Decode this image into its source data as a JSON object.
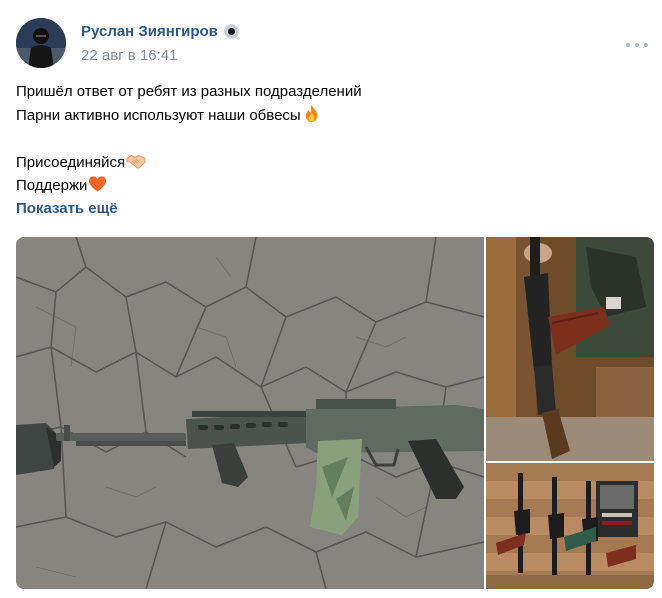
{
  "post": {
    "author": "Руслан Зиянгиров",
    "date": "22 авг в 16:41",
    "text_lines": [
      "Пришёл ответ от ребят из разных подразделений",
      "Парни активно используют наши обвесы",
      "",
      "Присоединяйся",
      "Поддержи"
    ],
    "show_more": "Показать ещё",
    "icons": {
      "line_2_emoji": "fire-emoji",
      "line_4_emoji": "handshake-emoji",
      "line_5_emoji": "orange-heart-emoji",
      "menu": "more-horizontal-icon",
      "verified": "verified-badge-icon"
    },
    "photos": [
      {
        "name": "rifle-on-cracked-ground-photo"
      },
      {
        "name": "rifle-held-in-hand-photo"
      },
      {
        "name": "rifles-on-wall-rack-photo"
      }
    ],
    "colors": {
      "link": "#2a5885",
      "secondary": "#818c99",
      "background": "#ffffff"
    }
  }
}
